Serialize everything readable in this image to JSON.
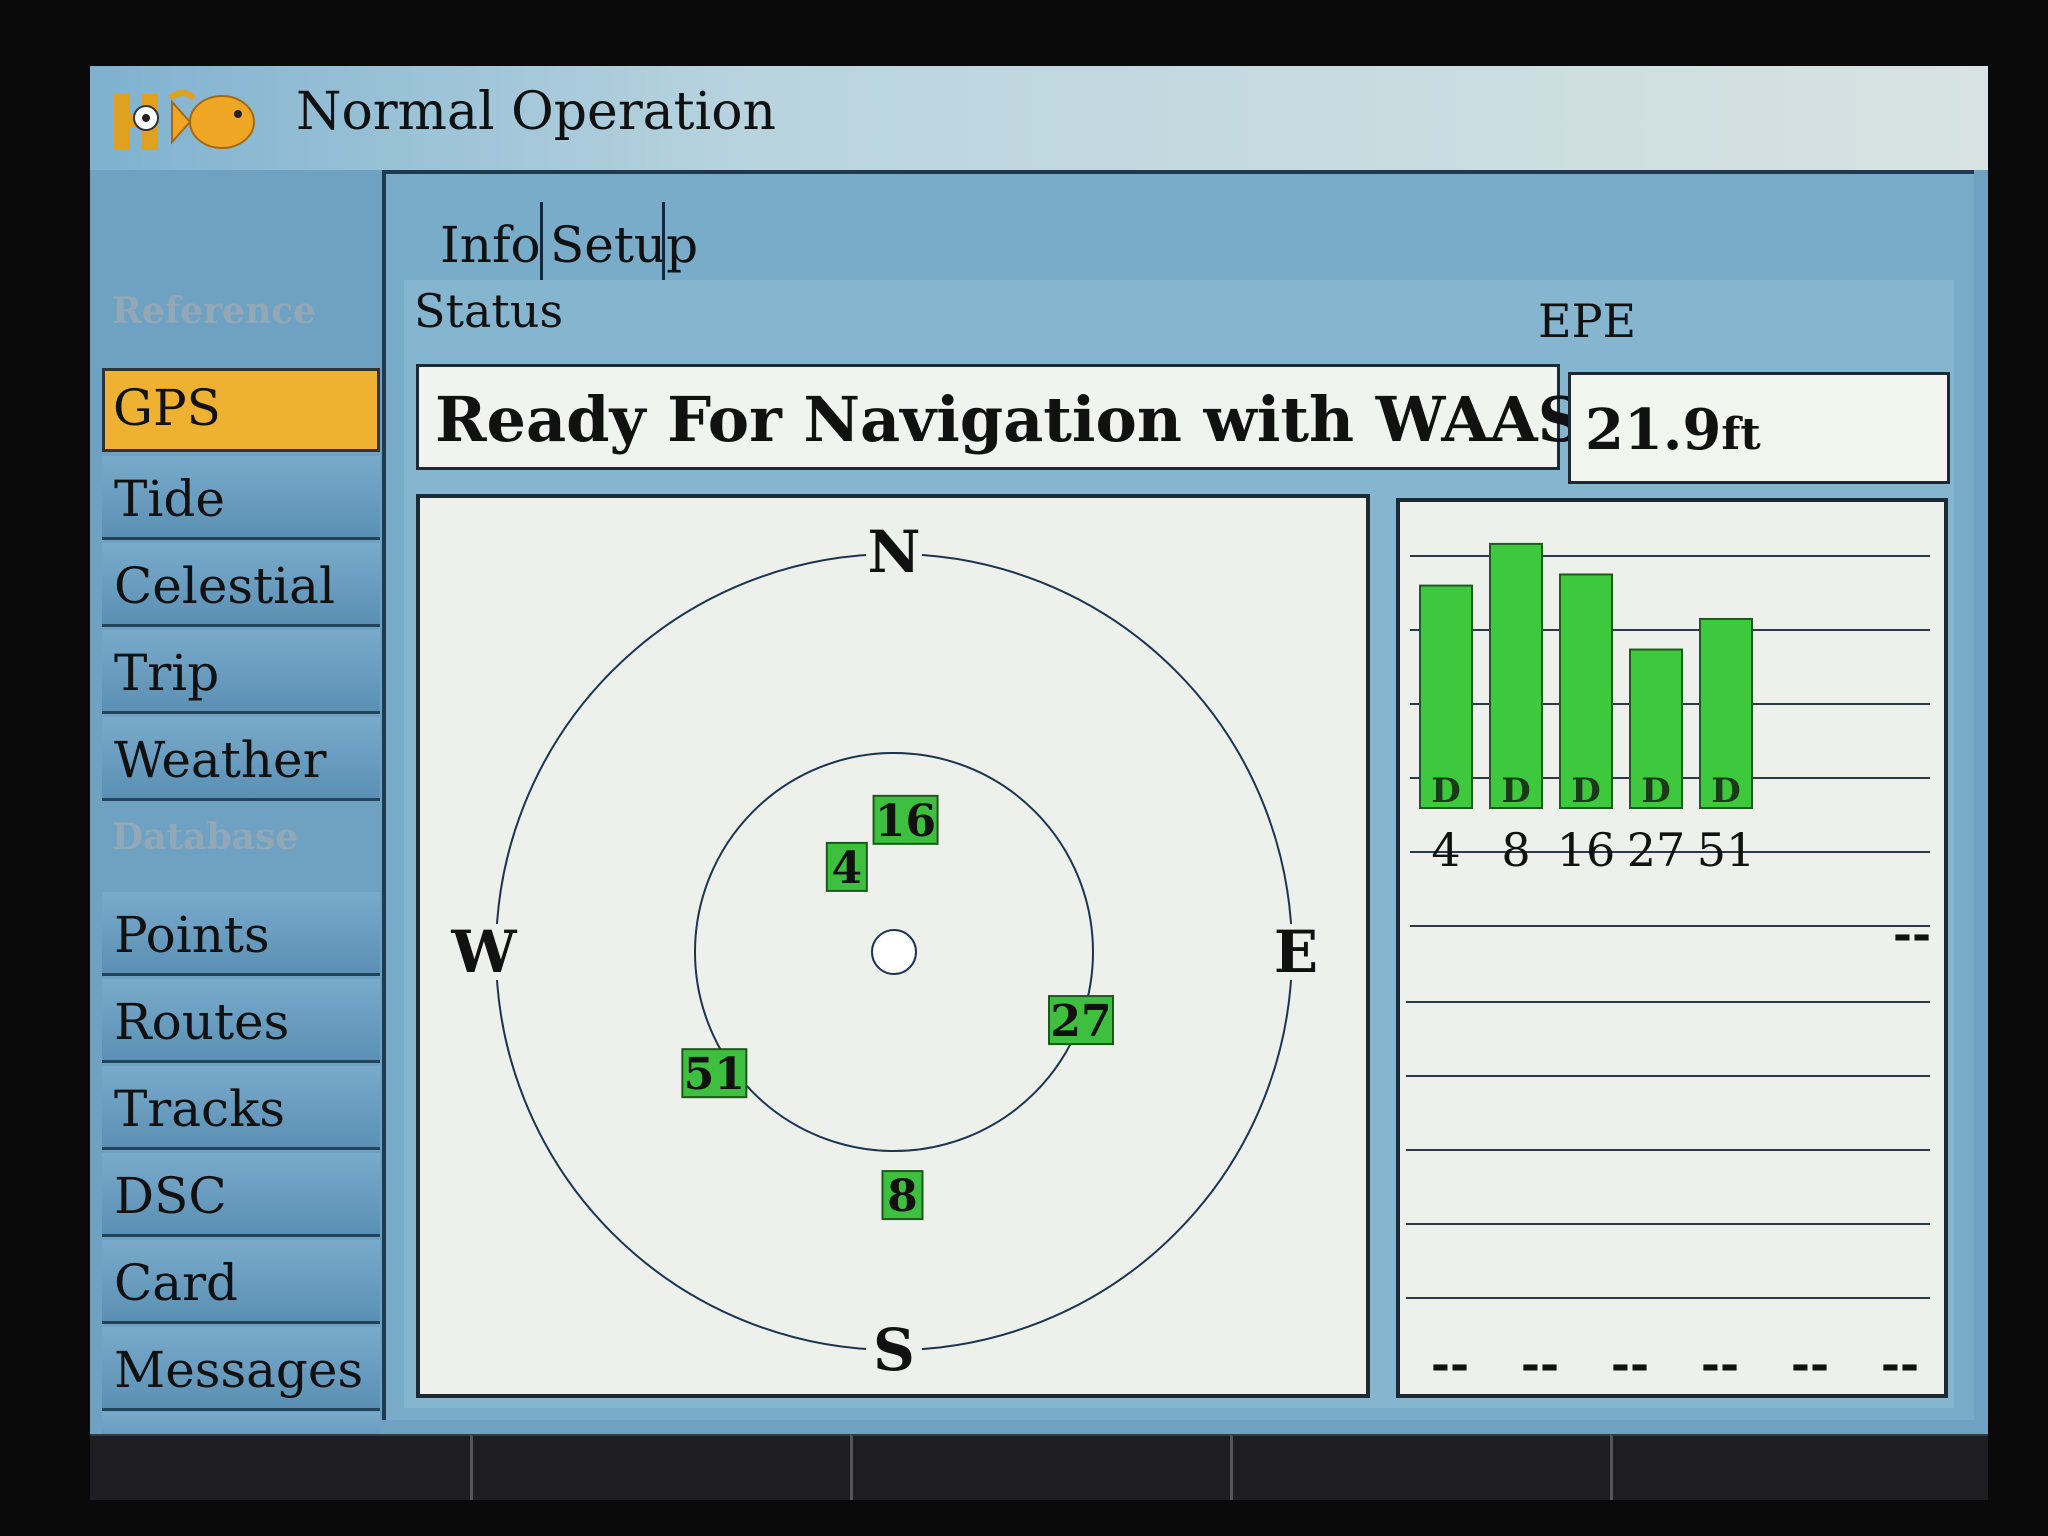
{
  "title": "Normal Operation",
  "logo": {
    "icon": "fish-icon"
  },
  "sidebar": {
    "sections": [
      "Reference",
      "Database"
    ],
    "items": [
      {
        "label": "GPS",
        "active": true
      },
      {
        "label": "Tide"
      },
      {
        "label": "Celestial"
      },
      {
        "label": "Trip"
      },
      {
        "label": "Weather"
      },
      {
        "label": "Points"
      },
      {
        "label": "Routes"
      },
      {
        "label": "Tracks"
      },
      {
        "label": "DSC"
      },
      {
        "label": "Card"
      },
      {
        "label": "Messages"
      }
    ]
  },
  "tabs": [
    {
      "label": "Info",
      "active": true
    },
    {
      "label": "Setup"
    }
  ],
  "status": {
    "label": "Status",
    "value": "Ready For Navigation with WAAS"
  },
  "epe": {
    "label": "EPE",
    "value": "21.9",
    "unit": "ft"
  },
  "sky": {
    "compass": {
      "n": "N",
      "e": "E",
      "s": "S",
      "w": "W"
    },
    "satellites": [
      {
        "id": "16",
        "azimuth": 5,
        "elevation": 60
      },
      {
        "id": "4",
        "azimuth": 331,
        "elevation": 68
      },
      {
        "id": "27",
        "azimuth": 110,
        "elevation": 45
      },
      {
        "id": "51",
        "azimuth": 236,
        "elevation": 41
      },
      {
        "id": "8",
        "azimuth": 178,
        "elevation": 35
      }
    ]
  },
  "signal": {
    "satellites": [
      {
        "id": "4",
        "strength": 0.8,
        "flag": "D"
      },
      {
        "id": "8",
        "strength": 0.95,
        "flag": "D"
      },
      {
        "id": "16",
        "strength": 0.84,
        "flag": "D"
      },
      {
        "id": "27",
        "strength": 0.57,
        "flag": "D"
      },
      {
        "id": "51",
        "strength": 0.68,
        "flag": "D"
      }
    ],
    "empty_slot": "--",
    "empty_row": [
      "--",
      "--",
      "--",
      "--",
      "--",
      "--"
    ]
  },
  "colors": {
    "sat_fill": "#3fbf3f",
    "bar_fill": "#3ec83e",
    "active_nav": "#eeb131"
  }
}
